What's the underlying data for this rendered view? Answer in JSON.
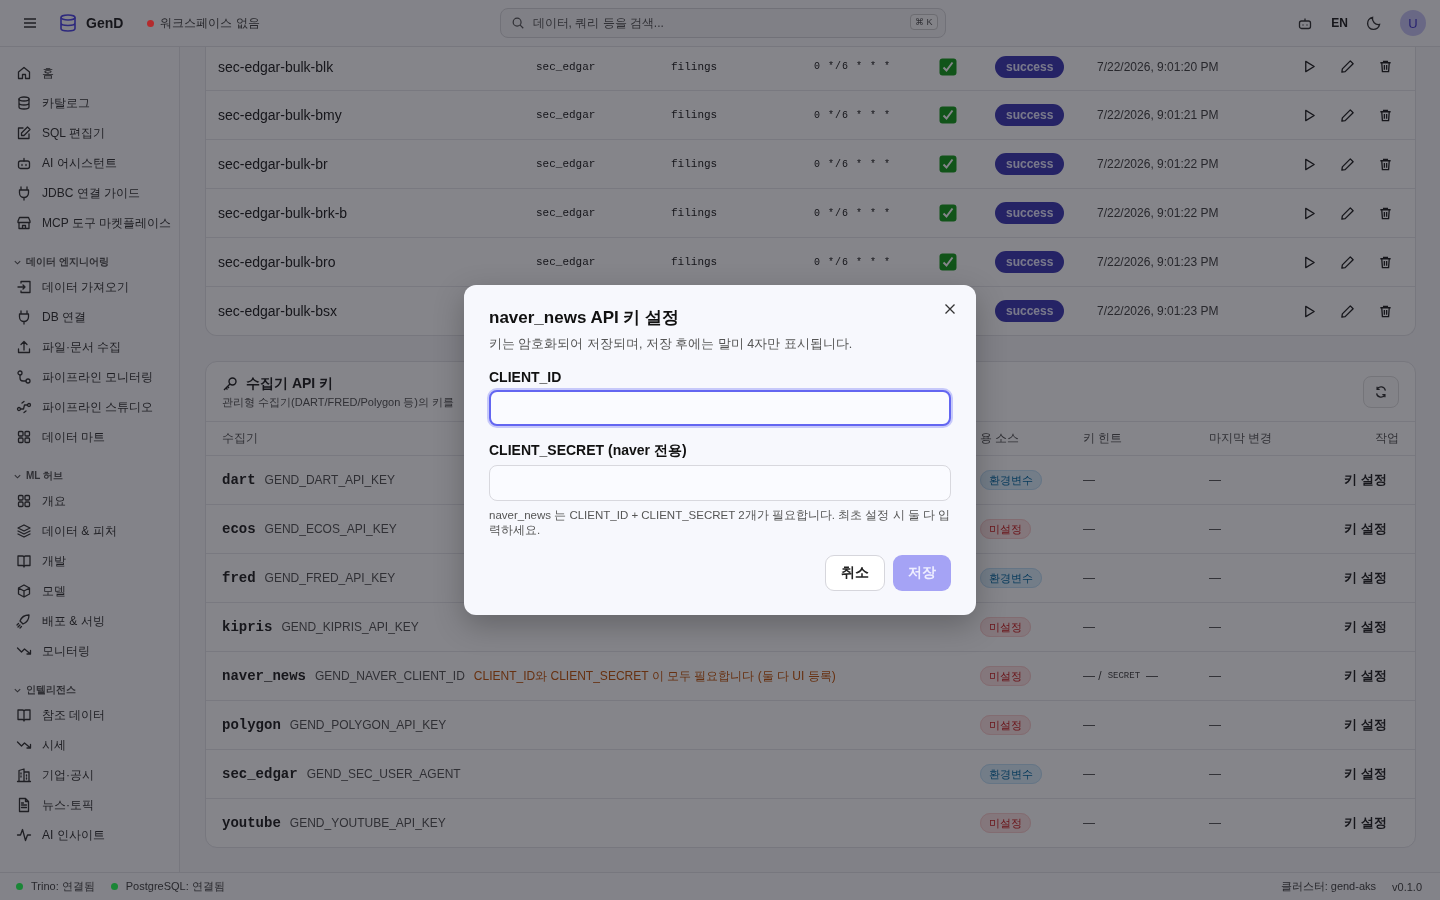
{
  "header": {
    "app_name": "GenD",
    "workspace": {
      "label": "워크스페이스 없음",
      "color": "#b42b2d"
    },
    "search": {
      "placeholder": "데이터, 쿼리 등을 검색...",
      "shortcut": "⌘ K"
    },
    "language": "EN",
    "avatar": "U"
  },
  "sidebar": {
    "items": [
      {
        "label": "홈",
        "selected": false
      },
      {
        "label": "카탈로그",
        "selected": false
      },
      {
        "label": "SQL 편집기",
        "selected": false
      },
      {
        "label": "AI 어시스턴트",
        "selected": false
      },
      {
        "label": "JDBC 연결 가이드",
        "selected": false
      },
      {
        "label": "MCP 도구 마켓플레이스",
        "selected": false
      }
    ],
    "sections": [
      {
        "title": "데이터 엔지니어링",
        "expanded": true,
        "items": [
          {
            "label": "데이터 가져오기",
            "selected": false
          },
          {
            "label": "DB 연결",
            "selected": false
          },
          {
            "label": "파일·문서 수집",
            "selected": false
          },
          {
            "label": "파이프라인 모니터링",
            "selected": false
          },
          {
            "label": "파이프라인 스튜디오",
            "selected": false
          },
          {
            "label": "데이터 마트",
            "selected": false
          }
        ]
      },
      {
        "title": "ML 허브",
        "expanded": true,
        "items": [
          {
            "label": "개요",
            "selected": false
          },
          {
            "label": "데이터 & 피처",
            "selected": false
          },
          {
            "label": "개발",
            "selected": false
          },
          {
            "label": "모델",
            "selected": false
          },
          {
            "label": "배포 & 서빙",
            "selected": false
          },
          {
            "label": "모니터링",
            "selected": false
          }
        ]
      },
      {
        "title": "인텔리전스",
        "expanded": true,
        "items": [
          {
            "label": "참조 데이터",
            "selected": false
          },
          {
            "label": "시세",
            "selected": false
          },
          {
            "label": "기업·공시",
            "selected": false
          },
          {
            "label": "뉴스·토픽",
            "selected": false
          },
          {
            "label": "AI 인사이트",
            "selected": false
          }
        ]
      }
    ]
  },
  "jobs_table": {
    "rows": [
      {
        "name": "sec-edgar-bulk-blk",
        "schema": "sec_edgar",
        "table": "filings",
        "cron": "0 */6 * * *",
        "enabled": true,
        "status": "success",
        "last_run": "7/22/2026, 9:01:20 PM"
      },
      {
        "name": "sec-edgar-bulk-bmy",
        "schema": "sec_edgar",
        "table": "filings",
        "cron": "0 */6 * * *",
        "enabled": true,
        "status": "success",
        "last_run": "7/22/2026, 9:01:21 PM"
      },
      {
        "name": "sec-edgar-bulk-br",
        "schema": "sec_edgar",
        "table": "filings",
        "cron": "0 */6 * * *",
        "enabled": true,
        "status": "success",
        "last_run": "7/22/2026, 9:01:22 PM"
      },
      {
        "name": "sec-edgar-bulk-brk-b",
        "schema": "sec_edgar",
        "table": "filings",
        "cron": "0 */6 * * *",
        "enabled": true,
        "status": "success",
        "last_run": "7/22/2026, 9:01:22 PM"
      },
      {
        "name": "sec-edgar-bulk-bro",
        "schema": "sec_edgar",
        "table": "filings",
        "cron": "0 */6 * * *",
        "enabled": true,
        "status": "success",
        "last_run": "7/22/2026, 9:01:23 PM"
      },
      {
        "name": "sec-edgar-bulk-bsx",
        "status": "success",
        "last_run": "7/22/2026, 9:01:23 PM"
      }
    ]
  },
  "api_keys": {
    "title": "수집기 API 키",
    "description": "관리형 수집기(DART/FRED/Polygon 등)의 키를",
    "columns": [
      "수집기",
      "용 소스",
      "키 힌트",
      "마지막 변경",
      "작업"
    ],
    "rows": [
      {
        "collector": "dart",
        "env_var": "GEND_DART_API_KEY",
        "source": {
          "kind": "env",
          "label": "환경변수"
        },
        "key_hint": "—",
        "last_changed": "—",
        "action": "키 설정"
      },
      {
        "collector": "ecos",
        "env_var": "GEND_ECOS_API_KEY",
        "source": {
          "kind": "unset",
          "label": "미설정"
        },
        "key_hint": "—",
        "last_changed": "—",
        "action": "키 설정"
      },
      {
        "collector": "fred",
        "env_var": "GEND_FRED_API_KEY",
        "source": {
          "kind": "env",
          "label": "환경변수"
        },
        "key_hint": "—",
        "last_changed": "—",
        "action": "키 설정"
      },
      {
        "collector": "kipris",
        "env_var": "GEND_KIPRIS_API_KEY",
        "source": {
          "kind": "unset",
          "label": "미설정"
        },
        "key_hint": "—",
        "last_changed": "—",
        "action": "키 설정"
      },
      {
        "collector": "naver_news",
        "env_var": "GEND_NAVER_CLIENT_ID",
        "warning": "CLIENT_ID와 CLIENT_SECRET 이 모두 필요합니다 (둘 다 UI 등록)",
        "source": {
          "kind": "unset",
          "label": "미설정"
        },
        "key_hint": "— /",
        "secret_label": "SECRET",
        "secret_hint": "—",
        "last_changed": "—",
        "action": "키 설정"
      },
      {
        "collector": "polygon",
        "env_var": "GEND_POLYGON_API_KEY",
        "source": {
          "kind": "unset",
          "label": "미설정"
        },
        "key_hint": "—",
        "last_changed": "—",
        "action": "키 설정"
      },
      {
        "collector": "sec_edgar",
        "env_var": "GEND_SEC_USER_AGENT",
        "source": {
          "kind": "env",
          "label": "환경변수"
        },
        "key_hint": "—",
        "last_changed": "—",
        "action": "키 설정"
      },
      {
        "collector": "youtube",
        "env_var": "GEND_YOUTUBE_API_KEY",
        "source": {
          "kind": "unset",
          "label": "미설정"
        },
        "key_hint": "—",
        "last_changed": "—",
        "action": "키 설정"
      }
    ]
  },
  "modal": {
    "title": "naver_news API 키 설정",
    "subtitle": "키는 암호화되어 저장되며, 저장 후에는 말미 4자만 표시됩니다.",
    "fields": [
      {
        "label": "CLIENT_ID",
        "focused": true
      },
      {
        "label": "CLIENT_SECRET (naver 전용)",
        "focused": false
      }
    ],
    "help": "naver_news 는 CLIENT_ID + CLIENT_SECRET 2개가 필요합니다. 최초 설정 시 둘 다 입력하세요.",
    "buttons": [
      {
        "label": "취소",
        "kind": "secondary",
        "disabled": false
      },
      {
        "label": "저장",
        "kind": "primary",
        "disabled": true
      }
    ]
  },
  "status_bar": {
    "connections": [
      {
        "label": "Trino: 연결됨",
        "color": "#1a8636"
      },
      {
        "label": "PostgreSQL: 연결됨",
        "color": "#1a8636"
      }
    ],
    "cluster": "클러스터: gend-aks",
    "version": "v0.1.0"
  }
}
